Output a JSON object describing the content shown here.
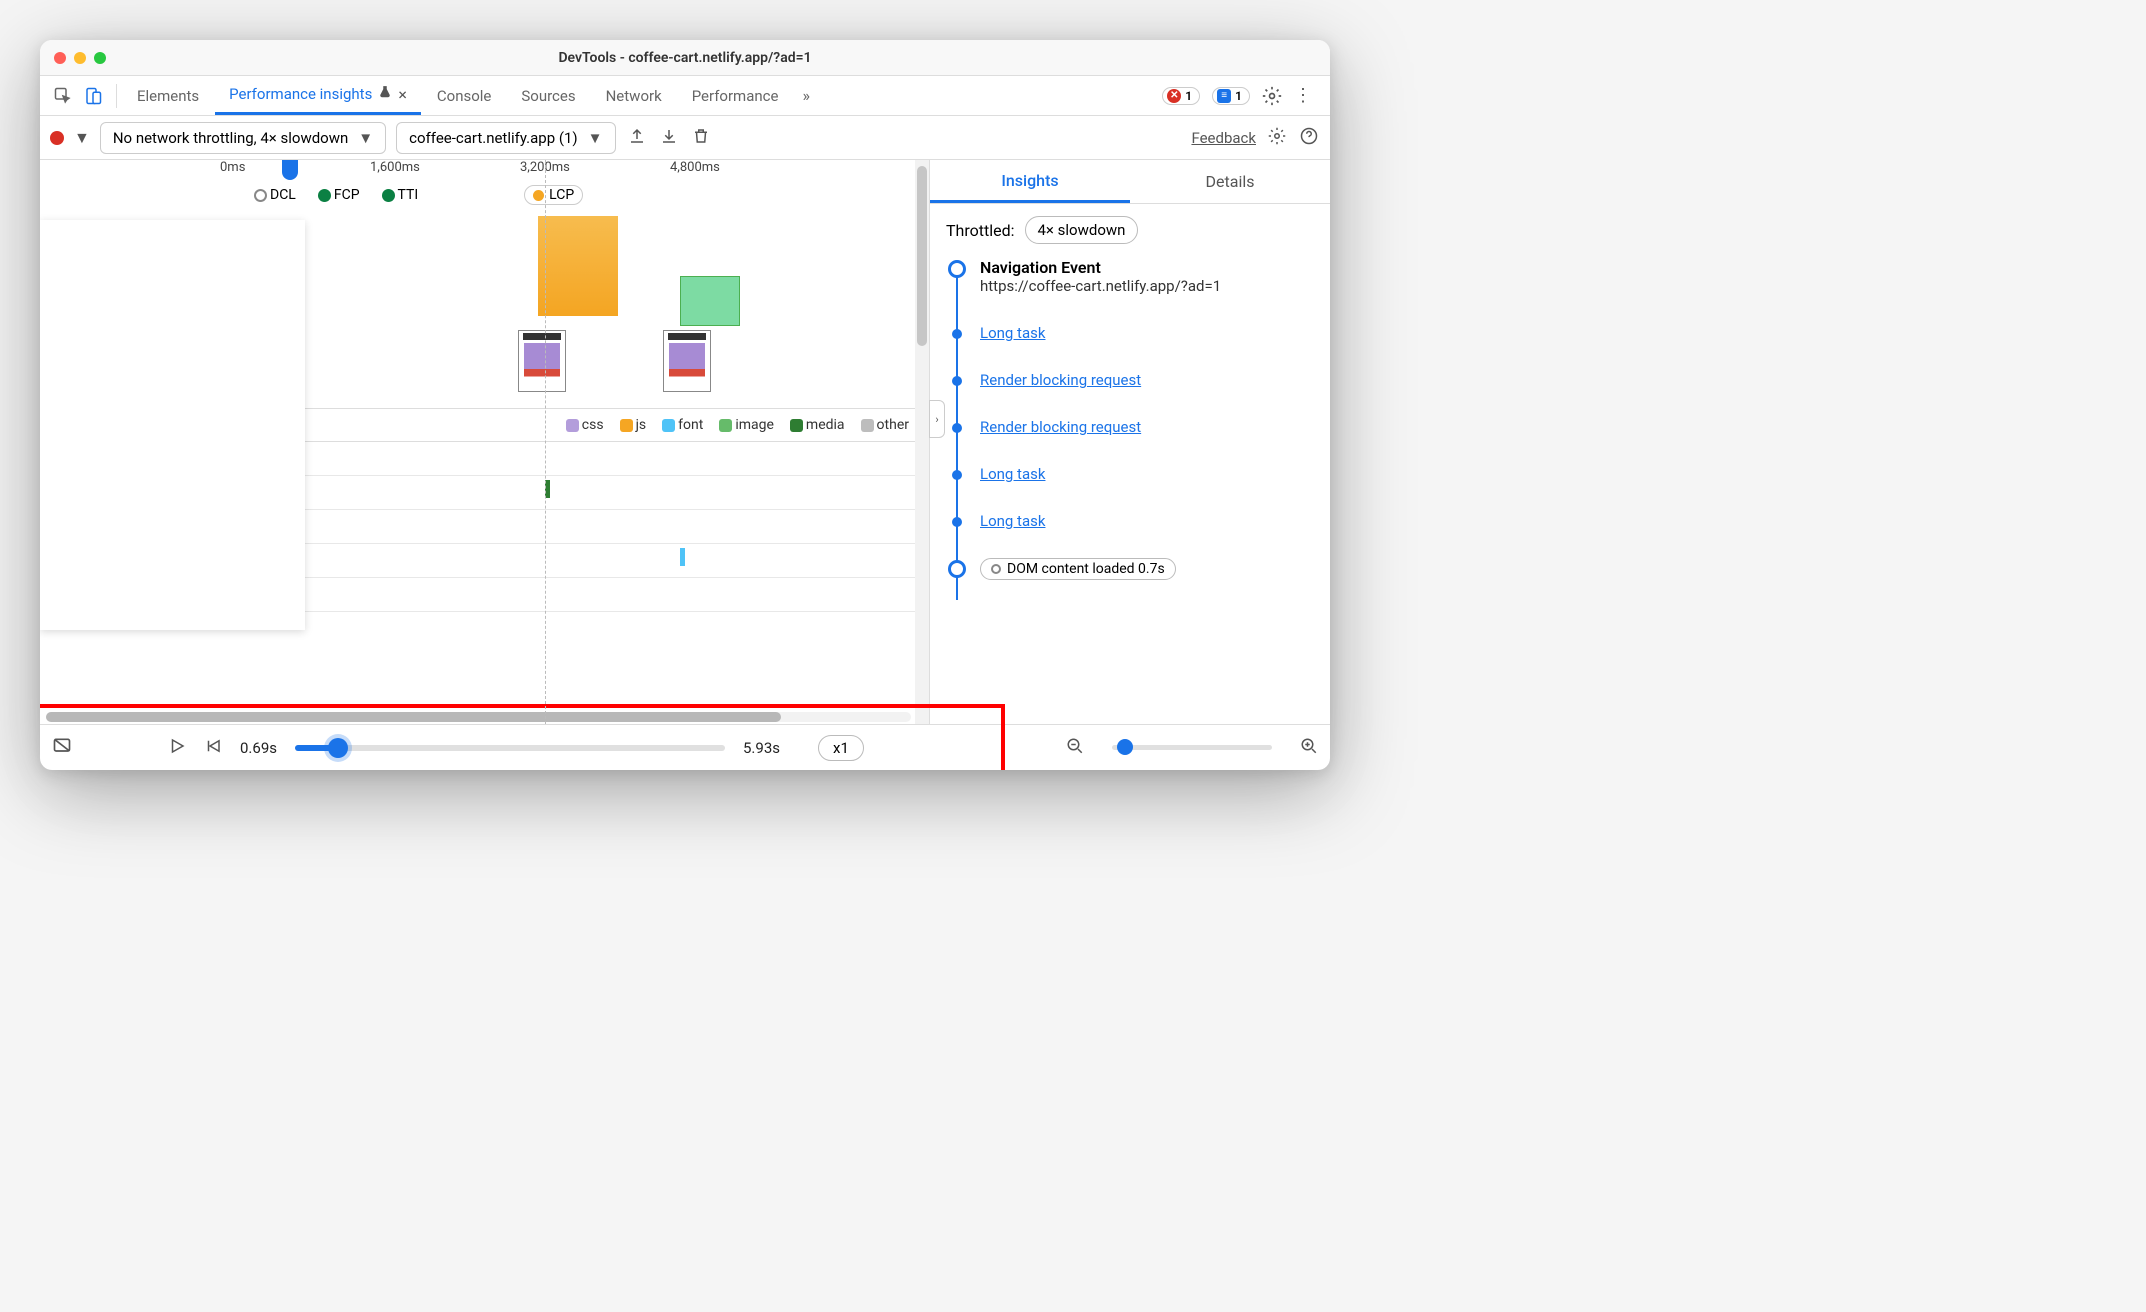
{
  "window": {
    "title": "DevTools - coffee-cart.netlify.app/?ad=1"
  },
  "tabs": {
    "elements": "Elements",
    "perfInsights": "Performance insights",
    "console": "Console",
    "sources": "Sources",
    "network": "Network",
    "performance": "Performance",
    "errorsCount": "1",
    "messagesCount": "1"
  },
  "toolbar": {
    "throttleSel": "No network throttling, 4× slowdown",
    "pageSel": "coffee-cart.netlify.app (1)",
    "feedback": "Feedback"
  },
  "ruler": {
    "t0": "0ms",
    "t1": "1,600ms",
    "t2": "3,200ms",
    "t3": "4,800ms"
  },
  "markers": {
    "dcl": "DCL",
    "fcp": "FCP",
    "tti": "TTI",
    "lcp": "LCP"
  },
  "legend": {
    "css": "css",
    "js": "js",
    "font": "font",
    "image": "image",
    "media": "media",
    "other": "other"
  },
  "sidebar": {
    "insights": "Insights",
    "details": "Details",
    "throttledLabel": "Throttled:",
    "throttledVal": "4× slowdown",
    "nav": {
      "title": "Navigation Event",
      "url": "https://coffee-cart.netlify.app/?ad=1"
    },
    "items": {
      "lt1": "Long task",
      "rb1": "Render blocking request",
      "rb2": "Render blocking request",
      "lt2": "Long task",
      "lt3": "Long task",
      "dcl": "DOM content loaded 0.7s"
    }
  },
  "footer": {
    "startTime": "0.69s",
    "endTime": "5.93s",
    "speed": "x1"
  }
}
